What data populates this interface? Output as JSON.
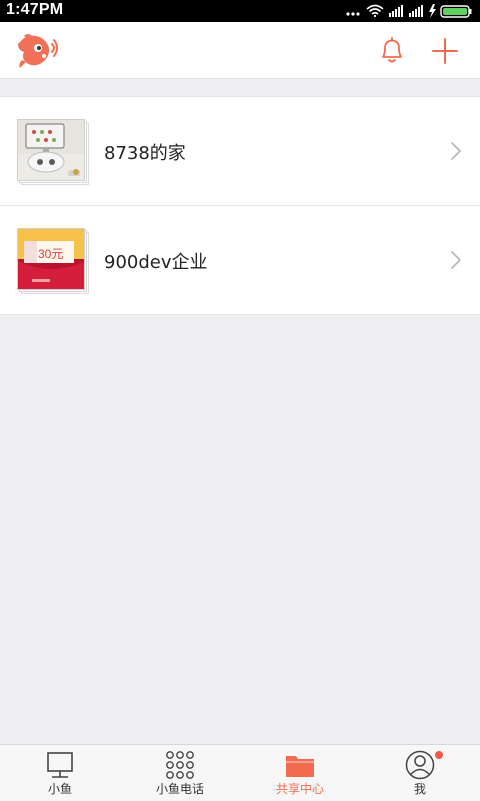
{
  "status_bar": {
    "time": "1:47PM"
  },
  "list": {
    "items": [
      {
        "label": "8738的家"
      },
      {
        "label": "900dev企业",
        "coupon_amount": "30元"
      }
    ]
  },
  "bottom_nav": {
    "tabs": [
      {
        "label": "小鱼",
        "icon": "monitor-icon"
      },
      {
        "label": "小鱼电话",
        "icon": "dialpad-icon"
      },
      {
        "label": "共享中心",
        "icon": "folder-icon",
        "active": true
      },
      {
        "label": "我",
        "icon": "user-icon"
      }
    ]
  },
  "colors": {
    "accent": "#f26b50",
    "background": "#eeeef0",
    "badge": "#f25a45"
  }
}
